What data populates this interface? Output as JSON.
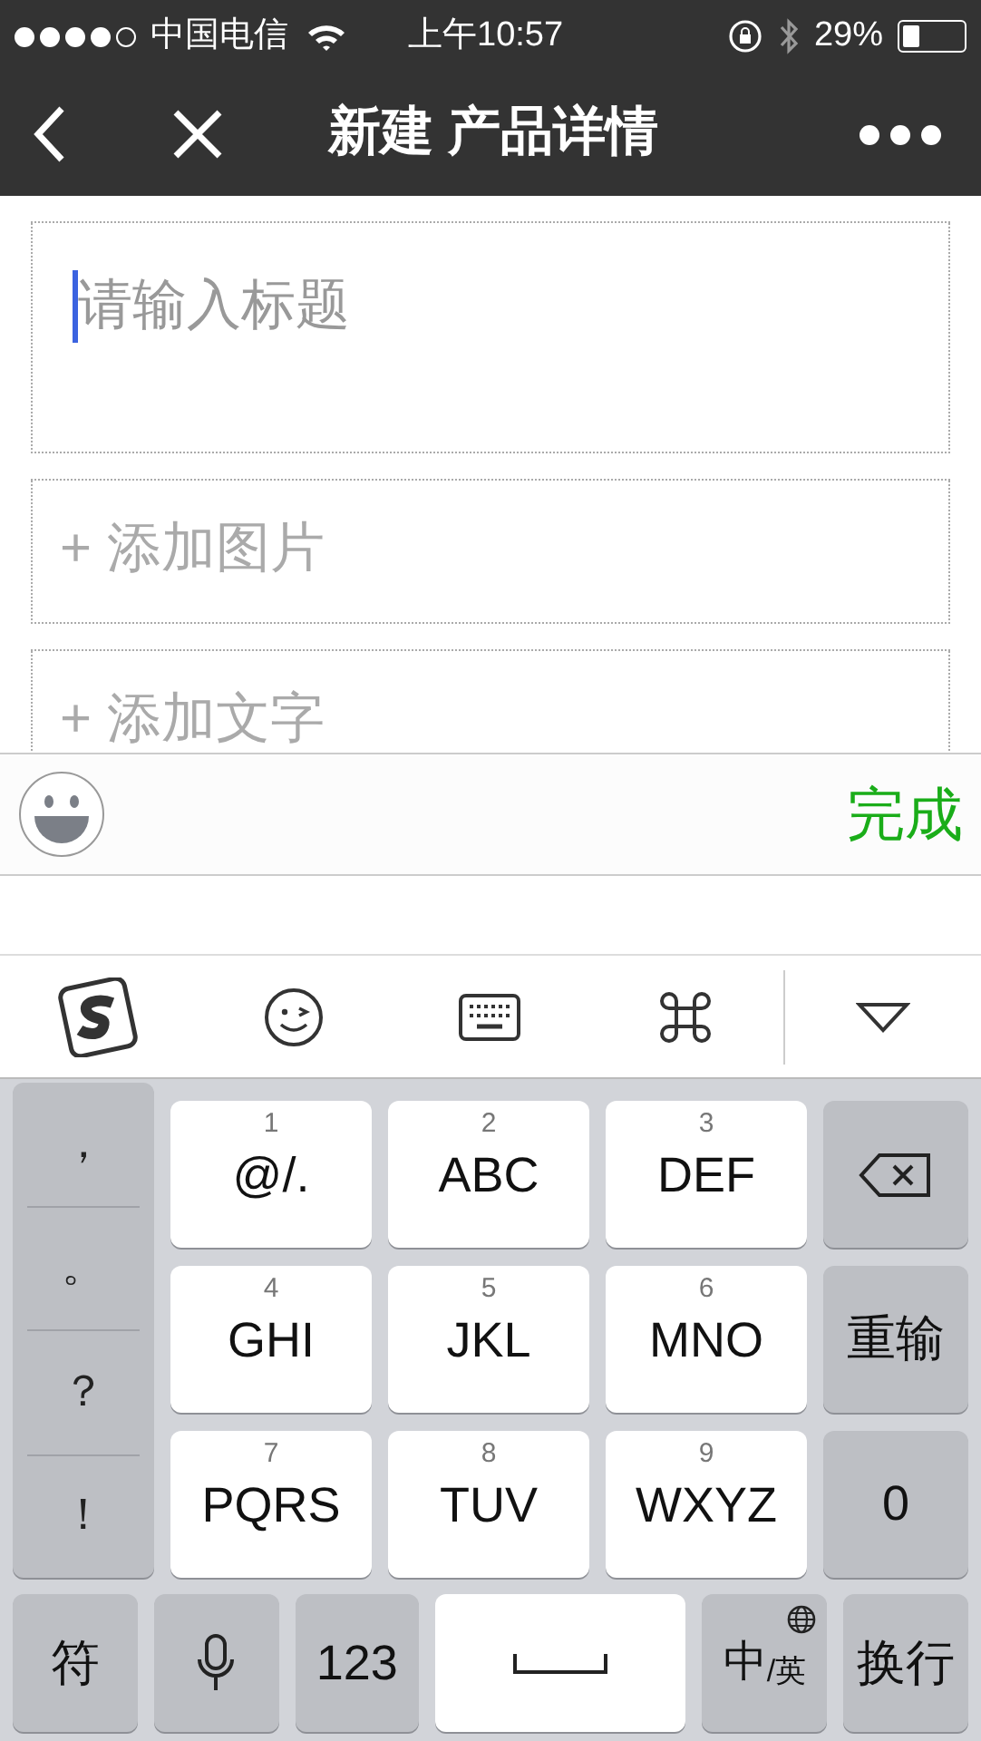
{
  "status_bar": {
    "carrier": "中国电信",
    "time": "上午10:57",
    "battery": "29%"
  },
  "nav_bar": {
    "title": "新建 产品详情"
  },
  "form": {
    "title_field": {
      "placeholder": "请输入标题"
    },
    "add_blocks": [
      {
        "label": "+ 添加图片"
      },
      {
        "label": "+ 添加文字"
      }
    ]
  },
  "input_toolbar": {
    "done": "完成"
  },
  "keyboard": {
    "punctuation": [
      "，",
      "。",
      "？",
      "！"
    ],
    "keys": [
      {
        "digit": "1",
        "letters": "@/."
      },
      {
        "digit": "2",
        "letters": "ABC"
      },
      {
        "digit": "3",
        "letters": "DEF"
      },
      {
        "digit": "4",
        "letters": "GHI"
      },
      {
        "digit": "5",
        "letters": "JKL"
      },
      {
        "digit": "6",
        "letters": "MNO"
      },
      {
        "digit": "7",
        "letters": "PQRS"
      },
      {
        "digit": "8",
        "letters": "TUV"
      },
      {
        "digit": "9",
        "letters": "WXYZ"
      }
    ],
    "side_keys": [
      {
        "kind": "backspace"
      },
      {
        "kind": "text",
        "label": "重输"
      },
      {
        "kind": "text",
        "label": "0"
      }
    ],
    "bottom_row": [
      {
        "kind": "text",
        "label": "符"
      },
      {
        "kind": "mic"
      },
      {
        "kind": "text",
        "label": "123"
      },
      {
        "kind": "space"
      },
      {
        "kind": "lang",
        "label": "中",
        "sub": "/英"
      },
      {
        "kind": "text",
        "label": "换行"
      }
    ]
  }
}
